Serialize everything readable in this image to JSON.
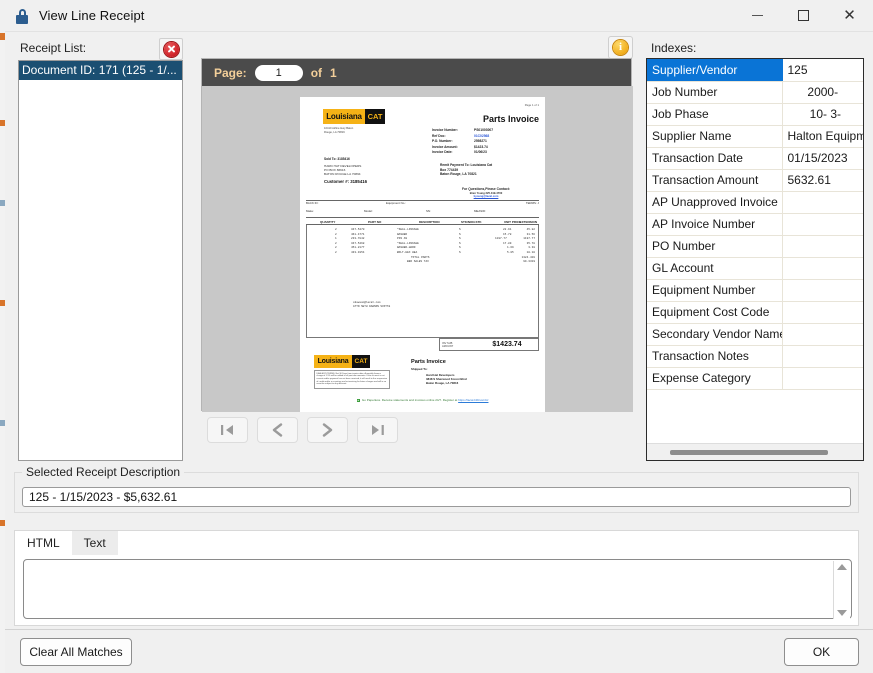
{
  "window": {
    "title": "View Line Receipt",
    "icon": "lock-icon",
    "controls": {
      "minimize": "—",
      "maximize": "□",
      "close": "✕"
    }
  },
  "receipt_list": {
    "label": "Receipt List:",
    "clear_button_icon": "red-x-icon",
    "items": [
      {
        "label": "Document ID: 171 (125 - 1/...",
        "selected": true
      }
    ]
  },
  "viewer": {
    "info_button_icon": "info-icon",
    "page_label": "Page:",
    "page_value": "1",
    "of_label": "of",
    "page_total": "1",
    "nav": [
      {
        "name": "first-page-button",
        "icon": "first-page-icon"
      },
      {
        "name": "previous-page-button",
        "icon": "chevron-left-icon"
      },
      {
        "name": "next-page-button",
        "icon": "chevron-right-icon"
      },
      {
        "name": "last-page-button",
        "icon": "last-page-icon"
      }
    ]
  },
  "document": {
    "page_number_note": "Page 1 of 1",
    "logo_brand": "Louisiana",
    "logo_mark": "CAT",
    "company_address": "10410 Airline Hwy Baton\nRouge, LA 70816",
    "title": "Parts Invoice",
    "meta": [
      {
        "key": "Invoice Number:",
        "value": "PS01003007",
        "blue": false
      },
      {
        "key": "Ref Doc:",
        "value": "01C02568",
        "blue": true
      },
      {
        "key": "P.O. Number:",
        "value": "2598271",
        "blue": false
      },
      {
        "key": "Invoice Amount:",
        "value": "$1423.74",
        "blue": false
      },
      {
        "key": "Invoice Date:",
        "value": "01/06/23",
        "blue": false
      }
    ],
    "sold_to_label": "Sold To:  3185416",
    "bill_address": "HARD HAT DEVELOPERS\nPO BOX 86616\nBATON ROUGE LA 70894",
    "customer_line": "Customer #: 3185416",
    "remit": "Remit Payment To: Louisiana Cat\nBox 774439\nBaton Rouge, LA 70821",
    "contact_title": "For Questions,Please Contact:",
    "contact_name": "Bren Young 225-319-4700",
    "contact_email": "byoung@lacat.com",
    "bar_row1": [
      "BACK ID:",
      "Equipment No.:",
      "TERMS:  J"
    ],
    "bar_row2": [
      "Make:",
      "Model:",
      "SN:",
      "MEASID:"
    ],
    "columns": [
      "QUANTITY",
      "PART NO",
      "DESCRIPTION",
      "STK/NON-STK",
      "UNIT PRICE",
      "EXTENSION"
    ],
    "rows": [
      {
        "qty": "2",
        "part": "347-5470",
        "desc": "*SEAL-LINKAGE",
        "stk": "S",
        "price": "22.91",
        "ext": "45.82"
      },
      {
        "qty": "2",
        "part": "461-4771",
        "desc": "WASHER",
        "stk": "S",
        "price": "15.78",
        "ext": "31.56"
      },
      {
        "qty": "1",
        "part": "233-7842",
        "desc": "PIN AS",
        "stk": "S",
        "price": "1197.77",
        "ext": "1197.77"
      },
      {
        "qty": "2",
        "part": "347-5468",
        "desc": "*SEAL-LINKAGE",
        "stk": "S",
        "price": "17.89",
        "ext": "35.78"
      },
      {
        "qty": "2",
        "part": "451-2177",
        "desc": "WASHER-HARD",
        "stk": "S",
        "price": "1.69",
        "ext": "3.38"
      },
      {
        "qty": "2",
        "part": "433-1954",
        "desc": "BOLT-HEX HEA",
        "stk": "S",
        "price": "5.05",
        "ext": "10.10"
      }
    ],
    "totals": [
      {
        "label": "TOTAL PARTS",
        "value": "1324.419"
      },
      {
        "label": "EBR SALES TAX",
        "value": "99.3319"
      }
    ],
    "note": "cdawson@lacat.com\nATTN SETH DAWSON SCOTT&",
    "total_label": "INV SUB\nAMOUNT",
    "total_value": "$1423.74",
    "terms_text": "DEALER'S TERMS: Net 30 Days from invoice date. A monthly finance charge of 1.5% will be added to all past due amounts. If the account is not current and/or payment has not been received, it will result in the suspension of credit and/or a re-pricing and re-invoicing for future charges and will in no event be subject to any discount.",
    "footer_title": "Parts Invoice",
    "shipped_to_label": "Shipped To:",
    "shipped_to": "Hard Hat Developers\n3848 S Sherwood Forest Blvd\nBaton Rouge, LA 70816",
    "footer_note": "Go Paperless.  Receive statements and invoices online 24/7. Register at",
    "footer_url": "https://lacat.billtrust.biz"
  },
  "indexes": {
    "label": "Indexes:",
    "rows": [
      {
        "key": "Supplier/Vendor",
        "value": "125",
        "align": "num",
        "selected": true
      },
      {
        "key": "Job Number",
        "value": "2000-",
        "align": "ctr",
        "selected": false
      },
      {
        "key": "Job Phase",
        "value": "10- 3-",
        "align": "rgt",
        "selected": false
      },
      {
        "key": "Supplier Name",
        "value": "Halton Equipm",
        "align": "num",
        "selected": false
      },
      {
        "key": "Transaction Date",
        "value": "01/15/2023",
        "align": "num",
        "selected": false
      },
      {
        "key": "Transaction Amount",
        "value": "5632.61",
        "align": "num",
        "selected": false
      },
      {
        "key": "AP Unapproved Invoice ID",
        "value": "",
        "align": "num",
        "selected": false
      },
      {
        "key": "AP Invoice Number",
        "value": "",
        "align": "num",
        "selected": false
      },
      {
        "key": "PO Number",
        "value": "",
        "align": "num",
        "selected": false
      },
      {
        "key": "GL Account",
        "value": "",
        "align": "num",
        "selected": false
      },
      {
        "key": "Equipment Number",
        "value": "",
        "align": "num",
        "selected": false
      },
      {
        "key": "Equipment Cost Code",
        "value": "",
        "align": "num",
        "selected": false
      },
      {
        "key": "Secondary Vendor Name",
        "value": "",
        "align": "num",
        "selected": false
      },
      {
        "key": "Transaction Notes",
        "value": "",
        "align": "num",
        "selected": false
      },
      {
        "key": "Expense Category",
        "value": "",
        "align": "num",
        "selected": false
      }
    ]
  },
  "selected_receipt": {
    "group_title": "Selected Receipt Description",
    "value": "125 - 1/15/2023 - $5,632.61"
  },
  "content_tabs": {
    "tabs": [
      {
        "label": "HTML",
        "state": "active"
      },
      {
        "label": "Text",
        "state": "hover"
      }
    ],
    "textarea_value": ""
  },
  "footer": {
    "clear_label": "Clear All Matches",
    "ok_label": "OK"
  },
  "colors": {
    "selection_navy": "#1b4f72",
    "grid_selection_blue": "#0a74d6",
    "toolbar_dark": "#4b4b4b",
    "toolbar_text": "#f3cf9a",
    "cat_yellow": "#f5b216"
  }
}
